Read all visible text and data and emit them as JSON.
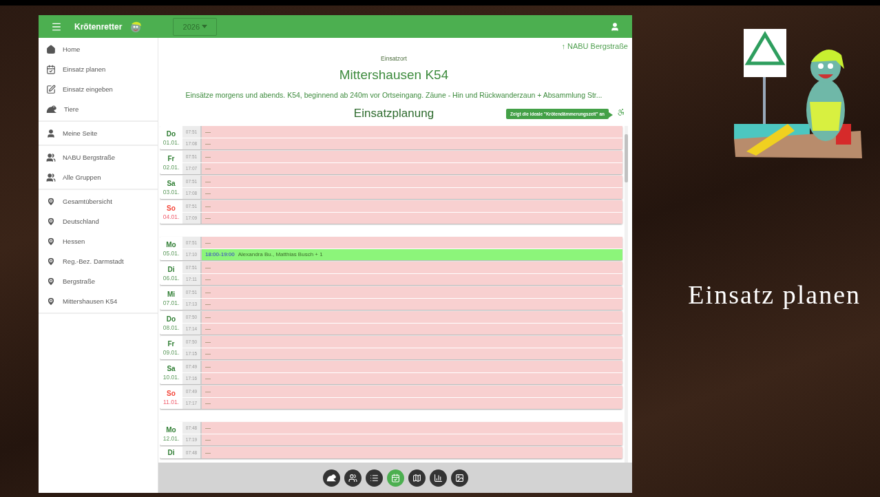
{
  "app": {
    "title": "Krötenretter",
    "year": "2026"
  },
  "sidebar": {
    "sections": [
      [
        {
          "label": "Home",
          "kind": "home",
          "selected": false
        },
        {
          "label": "Einsatz planen",
          "kind": "calendar",
          "selected": false
        },
        {
          "label": "Einsatz eingeben",
          "kind": "edit",
          "selected": false
        },
        {
          "label": "Tiere",
          "kind": "frog",
          "selected": false
        }
      ],
      [
        {
          "label": "Meine Seite",
          "kind": "user",
          "selected": false
        }
      ],
      [
        {
          "label": "NABU Bergstraße",
          "kind": "group",
          "selected": false
        },
        {
          "label": "Alle Gruppen",
          "kind": "group",
          "selected": false
        }
      ],
      [
        {
          "label": "Gesamtübersicht",
          "kind": "place",
          "selected": false
        },
        {
          "label": "Deutschland",
          "kind": "place",
          "selected": false
        },
        {
          "label": "Hessen",
          "kind": "place",
          "selected": false
        },
        {
          "label": "Reg.-Bez. Darmstadt",
          "kind": "place",
          "selected": false
        },
        {
          "label": "Bergstraße",
          "kind": "place",
          "selected": false
        },
        {
          "label": "Mittershausen K54",
          "kind": "place",
          "selected": false
        }
      ]
    ]
  },
  "page": {
    "parent_link": "↑ NABU Bergstraße",
    "location_label": "Einsatzort",
    "location": "Mittershausen K54",
    "description": "Einsätze morgens und abends. K54, beginnend ab 240m vor Ortseingang. Zäune - Hin und Rückwanderzaun + Absammlung Str...",
    "section_title": "Einsatzplanung",
    "tooltip": "Zeigt die ideale \"Krötendämmerungszeit\" an"
  },
  "weeks": [
    {
      "days": [
        {
          "weekday": "Do",
          "date": "01.01.",
          "sunday": false,
          "slots": [
            {
              "time": "07:51",
              "kind": "empty",
              "text": "—"
            },
            {
              "time": "17:08",
              "kind": "empty",
              "text": "—"
            }
          ]
        },
        {
          "weekday": "Fr",
          "date": "02.01.",
          "sunday": false,
          "slots": [
            {
              "time": "07:51",
              "kind": "empty",
              "text": "—"
            },
            {
              "time": "17:07",
              "kind": "empty",
              "text": "—"
            }
          ]
        },
        {
          "weekday": "Sa",
          "date": "03.01.",
          "sunday": false,
          "slots": [
            {
              "time": "07:51",
              "kind": "empty",
              "text": "—"
            },
            {
              "time": "17:08",
              "kind": "empty",
              "text": "—"
            }
          ]
        },
        {
          "weekday": "So",
          "date": "04.01.",
          "sunday": true,
          "slots": [
            {
              "time": "07:51",
              "kind": "empty",
              "text": "—"
            },
            {
              "time": "17:09",
              "kind": "empty",
              "text": "—"
            }
          ]
        }
      ]
    },
    {
      "days": [
        {
          "weekday": "Mo",
          "date": "05.01.",
          "sunday": false,
          "slots": [
            {
              "time": "07:51",
              "kind": "empty",
              "text": "—"
            },
            {
              "time": "17:10",
              "kind": "booked",
              "range": "18:00-19:00",
              "names": "Alexandra Bu., Matthias Busch + 1"
            }
          ]
        },
        {
          "weekday": "Di",
          "date": "06.01.",
          "sunday": false,
          "slots": [
            {
              "time": "07:51",
              "kind": "empty",
              "text": "—"
            },
            {
              "time": "17:11",
              "kind": "empty",
              "text": "—"
            }
          ]
        },
        {
          "weekday": "Mi",
          "date": "07.01.",
          "sunday": false,
          "slots": [
            {
              "time": "07:51",
              "kind": "empty",
              "text": "—"
            },
            {
              "time": "17:13",
              "kind": "empty",
              "text": "—"
            }
          ]
        },
        {
          "weekday": "Do",
          "date": "08.01.",
          "sunday": false,
          "slots": [
            {
              "time": "07:50",
              "kind": "empty",
              "text": "—"
            },
            {
              "time": "17:14",
              "kind": "empty",
              "text": "—"
            }
          ]
        },
        {
          "weekday": "Fr",
          "date": "09.01.",
          "sunday": false,
          "slots": [
            {
              "time": "07:50",
              "kind": "empty",
              "text": "—"
            },
            {
              "time": "17:15",
              "kind": "empty",
              "text": "—"
            }
          ]
        },
        {
          "weekday": "Sa",
          "date": "10.01.",
          "sunday": false,
          "slots": [
            {
              "time": "07:49",
              "kind": "empty",
              "text": "—"
            },
            {
              "time": "17:16",
              "kind": "empty",
              "text": "—"
            }
          ]
        },
        {
          "weekday": "So",
          "date": "11.01.",
          "sunday": true,
          "slots": [
            {
              "time": "07:49",
              "kind": "empty",
              "text": "—"
            },
            {
              "time": "17:17",
              "kind": "empty",
              "text": "—"
            }
          ]
        }
      ]
    },
    {
      "days": [
        {
          "weekday": "Mo",
          "date": "12.01.",
          "sunday": false,
          "slots": [
            {
              "time": "07:48",
              "kind": "empty",
              "text": "—"
            },
            {
              "time": "17:19",
              "kind": "empty",
              "text": "—"
            }
          ]
        },
        {
          "weekday": "Di",
          "sunday": false,
          "slots": [
            {
              "time": "07:48",
              "kind": "empty",
              "text": "—"
            }
          ]
        }
      ]
    }
  ],
  "bottom_nav": [
    {
      "kind": "frog",
      "selected": false
    },
    {
      "kind": "people",
      "selected": false
    },
    {
      "kind": "list",
      "selected": false
    },
    {
      "kind": "calendar",
      "selected": true
    },
    {
      "kind": "map",
      "selected": false
    },
    {
      "kind": "chart",
      "selected": false
    },
    {
      "kind": "image",
      "selected": false
    }
  ],
  "slide": {
    "caption": "Einsatz planen"
  }
}
